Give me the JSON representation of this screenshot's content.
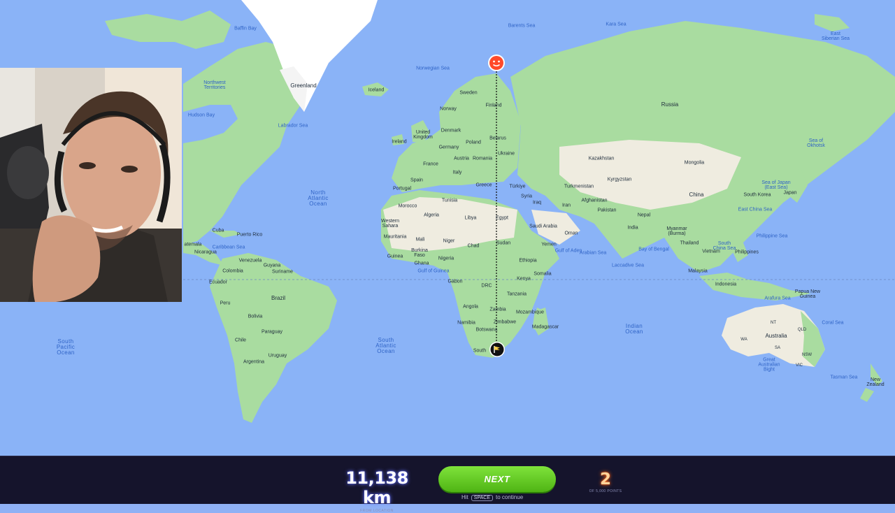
{
  "map": {
    "oceans": {
      "north_atlantic": "North\nAtlantic\nOcean",
      "south_atlantic": "South\nAtlantic\nOcean",
      "south_pacific": "South\nPacific\nOcean",
      "indian": "Indian\nOcean"
    },
    "seas": {
      "baffin_bay": "Baffin Bay",
      "barents_sea": "Barents Sea",
      "kara_sea": "Kara Sea",
      "east_siberian_sea": "East\nSiberian Sea",
      "norwegian_sea": "Norwegian Sea",
      "hudson_bay": "Hudson Bay",
      "labrador_sea": "Labrador Sea",
      "caribbean_sea": "Caribbean Sea",
      "gulf_of_guinea": "Gulf of Guinea",
      "arabian_sea": "Arabian Sea",
      "bay_of_bengal": "Bay of Bengal",
      "laccadive_sea": "Laccadive Sea",
      "south_china_sea": "South\nChina Sea",
      "east_china_sea": "East China Sea",
      "philippine_sea": "Philippine Sea",
      "sea_of_japan": "Sea of Japan\n(East Sea)",
      "sea_of_okhotsk": "Sea of\nOkhotsk",
      "arafura_sea": "Arafura Sea",
      "coral_sea": "Coral Sea",
      "tasman_sea": "Tasman Sea",
      "great_australian_bight": "Great\nAustralian\nBight",
      "gulf_of_aden": "Gulf of Aden"
    },
    "countries": {
      "greenland": "Greenland",
      "iceland": "Iceland",
      "northwest_territories": "Northwest\nTerritories",
      "sweden": "Sweden",
      "norway": "Norway",
      "finland": "Finland",
      "russia": "Russia",
      "united_kingdom": "United\nKingdom",
      "ireland": "Ireland",
      "denmark": "Denmark",
      "poland": "Poland",
      "belarus": "Belarus",
      "germany": "Germany",
      "ukraine": "Ukraine",
      "france": "France",
      "austria": "Austria",
      "romania": "Romania",
      "italy": "Italy",
      "spain": "Spain",
      "portugal": "Portugal",
      "greece": "Greece",
      "turkiye": "Türkiye",
      "kazakhstan": "Kazakhstan",
      "mongolia": "Mongolia",
      "turkmenistan": "Turkmenistan",
      "kyrgyzstan": "Kyrgyzstan",
      "china": "China",
      "south_korea": "South Korea",
      "japan": "Japan",
      "syria": "Syria",
      "iraq": "Iraq",
      "iran": "Iran",
      "afghanistan": "Afghanistan",
      "pakistan": "Pakistan",
      "nepal": "Nepal",
      "india": "India",
      "myanmar": "Myanmar\n(Burma)",
      "thailand": "Thailand",
      "vietnam": "Vietnam",
      "philippines": "Philippines",
      "malaysia": "Malaysia",
      "indonesia": "Indonesia",
      "papua_new_guinea": "Papua New\nGuinea",
      "australia": "Australia",
      "new_zealand": "New\nZealand",
      "morocco": "Morocco",
      "tunisia": "Tunisia",
      "algeria": "Algeria",
      "libya": "Libya",
      "egypt": "Egypt",
      "western_sahara": "Western\nSahara",
      "mauritania": "Mauritania",
      "mali": "Mali",
      "niger": "Niger",
      "chad": "Chad",
      "sudan": "Sudan",
      "saudi_arabia": "Saudi Arabia",
      "yemen": "Yemen",
      "oman": "Oman",
      "burkina_faso": "Burkina\nFaso",
      "guinea": "Guinea",
      "ghana": "Ghana",
      "nigeria": "Nigeria",
      "ethiopia": "Ethiopia",
      "somalia": "Somalia",
      "gabon": "Gabon",
      "drc": "DRC",
      "kenya": "Kenya",
      "tanzania": "Tanzania",
      "angola": "Angola",
      "zambia": "Zambia",
      "mozambique": "Mozambique",
      "namibia": "Namibia",
      "zimbabwe": "Zimbabwe",
      "botswana": "Botswana",
      "madagascar": "Madagascar",
      "south_africa": "South",
      "cuba": "Cuba",
      "puerto_rico": "Puerto Rico",
      "nicaragua": "Nicaragua",
      "guatemala": "atemala",
      "venezuela": "Venezuela",
      "guyana": "Guyana",
      "colombia": "Colombia",
      "suriname": "Suriname",
      "ecuador": "Ecuador",
      "peru": "Peru",
      "brazil": "Brazil",
      "bolivia": "Bolivia",
      "paraguay": "Paraguay",
      "chile": "Chile",
      "argentina": "Argentina",
      "uruguay": "Uruguay"
    },
    "au_states": {
      "nt": "NT",
      "qld": "QLD",
      "wa": "WA",
      "sa": "SA",
      "nsw": "NSW",
      "vic": "VIC"
    },
    "colors": {
      "ocean": "#8ab3f7",
      "land": "#a9dca0",
      "desert": "#efece0",
      "ice": "#ffffff",
      "guess_pin": "#ff4a2a",
      "actual_pin": "#111111"
    }
  },
  "result": {
    "distance": "11,138 km",
    "distance_caption": "FROM LOCATION",
    "next_button": "NEXT",
    "hint_prefix": "Hit",
    "hint_key": "SPACE",
    "hint_suffix": "to continue",
    "points": "2",
    "points_caption": "OF 5,000 POINTS"
  },
  "webcam": {
    "icon": "streamer-webcam-feed"
  },
  "pins": {
    "guess_icon": "smiley-face-pin-icon",
    "actual_icon": "flag-pin-icon"
  }
}
